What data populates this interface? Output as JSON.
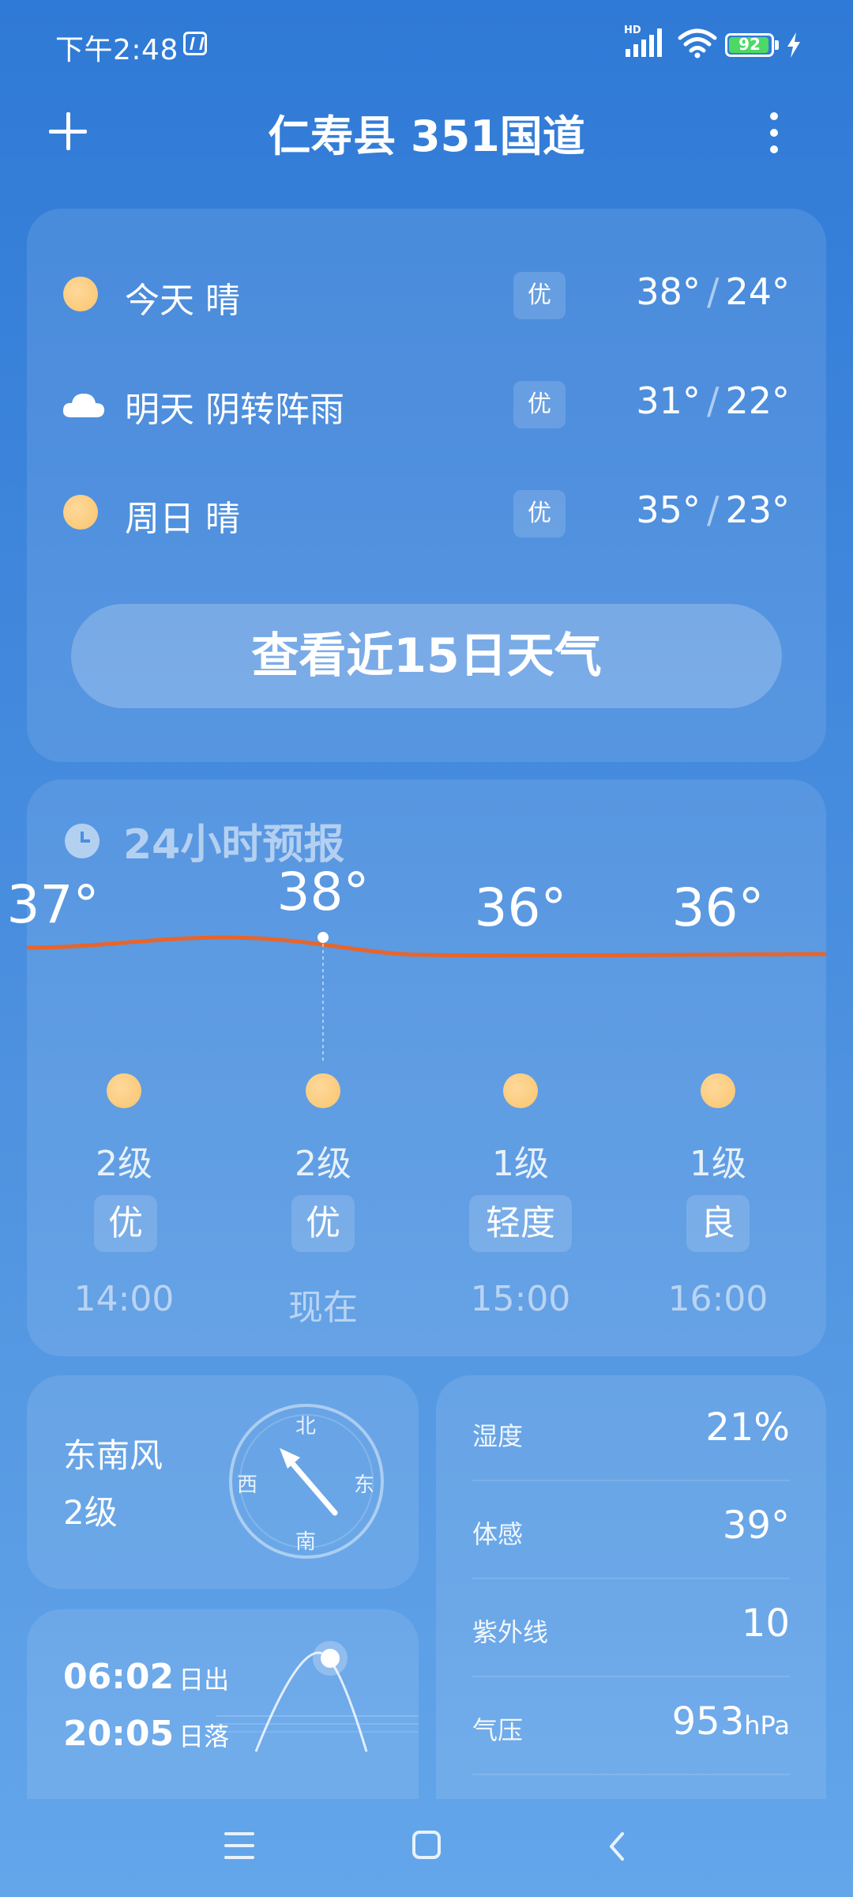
{
  "status_bar": {
    "time": "下午2:48",
    "network_label": "HD",
    "battery": "92"
  },
  "header": {
    "title": "仁寿县 351国道"
  },
  "daily": [
    {
      "label": "今天  晴",
      "icon": "sun-icon",
      "aqi": "优",
      "high": "38°",
      "low": "24°",
      "sep": "/"
    },
    {
      "label": "明天  阴转阵雨",
      "icon": "cloud-icon",
      "aqi": "优",
      "high": "31°",
      "low": "22°",
      "sep": "/"
    },
    {
      "label": "周日  晴",
      "icon": "sun-icon",
      "aqi": "优",
      "high": "35°",
      "low": "23°",
      "sep": "/"
    }
  ],
  "view15_label": "查看近15日天气",
  "hourly": {
    "title": "24小时预报",
    "items": [
      {
        "temp": "37°",
        "wind": "2级",
        "aqi": "优",
        "time": "14:00",
        "icon": "sun-icon"
      },
      {
        "temp": "38°",
        "wind": "2级",
        "aqi": "优",
        "time": "现在",
        "icon": "sun-icon"
      },
      {
        "temp": "36°",
        "wind": "1级",
        "aqi": "轻度",
        "time": "15:00",
        "icon": "sun-icon"
      },
      {
        "temp": "36°",
        "wind": "1级",
        "aqi": "良",
        "time": "16:00",
        "icon": "sun-icon"
      }
    ],
    "line_color": "#e8652a"
  },
  "wind": {
    "direction": "东南风",
    "level": "2级",
    "compass": {
      "n": "北",
      "s": "南",
      "e": "东",
      "w": "西"
    }
  },
  "sun": {
    "sunrise": "06:02",
    "sunrise_label": "日出",
    "sunset": "20:05",
    "sunset_label": "日落"
  },
  "details": [
    {
      "label": "湿度",
      "value": "21%",
      "unit": ""
    },
    {
      "label": "体感",
      "value": "39°",
      "unit": ""
    },
    {
      "label": "紫外线",
      "value": "10",
      "unit": ""
    },
    {
      "label": "气压",
      "value": "953",
      "unit": "hPa"
    }
  ]
}
